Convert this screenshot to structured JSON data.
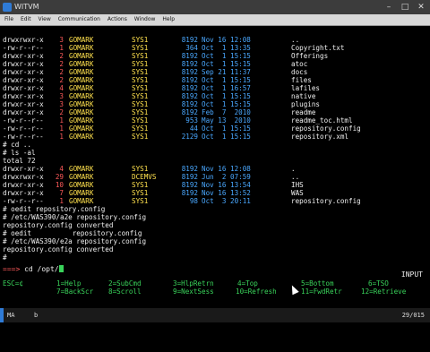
{
  "window": {
    "title": "WITVM"
  },
  "menu": [
    "File",
    "Edit",
    "View",
    "Communication",
    "Actions",
    "Window",
    "Help"
  ],
  "listing1": [
    {
      "perm": "drwxrwxr-x",
      "links": "3",
      "owner": "GOMARK",
      "group": "SYS1",
      "size": "8192",
      "date": "Nov 16 12:08",
      "name": ".."
    },
    {
      "perm": "-rw-r--r--",
      "links": "1",
      "owner": "GOMARK",
      "group": "SYS1",
      "size": "364",
      "date": "Oct  1 13:35",
      "name": "Copyright.txt"
    },
    {
      "perm": "drwxr-xr-x",
      "links": "2",
      "owner": "GOMARK",
      "group": "SYS1",
      "size": "8192",
      "date": "Oct  1 15:15",
      "name": "Offerings"
    },
    {
      "perm": "drwxr-xr-x",
      "links": "2",
      "owner": "GOMARK",
      "group": "SYS1",
      "size": "8192",
      "date": "Oct  1 15:15",
      "name": "atoc"
    },
    {
      "perm": "drwxr-xr-x",
      "links": "2",
      "owner": "GOMARK",
      "group": "SYS1",
      "size": "8192",
      "date": "Sep 21 11:37",
      "name": "docs"
    },
    {
      "perm": "drwxr-xr-x",
      "links": "2",
      "owner": "GOMARK",
      "group": "SYS1",
      "size": "8192",
      "date": "Oct  1 15:15",
      "name": "files"
    },
    {
      "perm": "drwxr-xr-x",
      "links": "4",
      "owner": "GOMARK",
      "group": "SYS1",
      "size": "8192",
      "date": "Oct  1 16:57",
      "name": "lafiles"
    },
    {
      "perm": "drwxr-xr-x",
      "links": "3",
      "owner": "GOMARK",
      "group": "SYS1",
      "size": "8192",
      "date": "Oct  1 15:15",
      "name": "native"
    },
    {
      "perm": "drwxr-xr-x",
      "links": "3",
      "owner": "GOMARK",
      "group": "SYS1",
      "size": "8192",
      "date": "Oct  1 15:15",
      "name": "plugins"
    },
    {
      "perm": "drwxr-xr-x",
      "links": "2",
      "owner": "GOMARK",
      "group": "SYS1",
      "size": "8192",
      "date": "Feb  7  2010",
      "name": "readme"
    },
    {
      "perm": "-rw-r--r--",
      "links": "1",
      "owner": "GOMARK",
      "group": "SYS1",
      "size": "953",
      "date": "May 13  2010",
      "name": "readme_toc.html"
    },
    {
      "perm": "-rw-r--r--",
      "links": "1",
      "owner": "GOMARK",
      "group": "SYS1",
      "size": "44",
      "date": "Oct  1 15:15",
      "name": "repository.config"
    },
    {
      "perm": "-rw-r--r--",
      "links": "1",
      "owner": "GOMARK",
      "group": "SYS1",
      "size": "2129",
      "date": "Oct  1 15:15",
      "name": "repository.xml"
    }
  ],
  "cmd1": "# cd ..",
  "cmd2": "# ls -al",
  "total": "total 72",
  "listing2": [
    {
      "perm": "drwxr-xr-x",
      "links": "4",
      "owner": "GOMARK",
      "group": "SYS1",
      "size": "8192",
      "date": "Nov 16 12:08",
      "name": "."
    },
    {
      "perm": "drwxrwxr-x",
      "links": "29",
      "owner": "GOMARK",
      "group": "DCEMVS",
      "size": "8192",
      "date": "Jun  2 07:59",
      "name": ".."
    },
    {
      "perm": "drwxr-xr-x",
      "links": "10",
      "owner": "GOMARK",
      "group": "SYS1",
      "size": "8192",
      "date": "Nov 16 13:54",
      "name": "IHS"
    },
    {
      "perm": "drwxr-xr-x",
      "links": "7",
      "owner": "GOMARK",
      "group": "SYS1",
      "size": "8192",
      "date": "Nov 16 13:52",
      "name": "WAS"
    },
    {
      "perm": "-rw-r--r--",
      "links": "1",
      "owner": "GOMARK",
      "group": "SYS1",
      "size": "98",
      "date": "Oct  3 20:11",
      "name": "repository.config"
    }
  ],
  "tail_lines": [
    "# oedit repository.config",
    "# /etc/WAS390/a2e repository.config",
    "repository.config converted",
    "# oedit          repository.config",
    "# /etc/WAS390/e2a repository.config",
    "repository.config converted",
    "#"
  ],
  "prompt": {
    "arrow": "===>",
    "text": " cd /opt/"
  },
  "input_label": "INPUT",
  "fkeys_row1": [
    {
      "key": "ESC=¢",
      "label": ""
    },
    {
      "key": "1=Help",
      "label": ""
    },
    {
      "key": "2=SubCmd",
      "label": ""
    },
    {
      "key": "3=HlpRetrn",
      "label": ""
    },
    {
      "key": "4=Top",
      "label": ""
    },
    {
      "key": "5=Bottom",
      "label": ""
    },
    {
      "key": "6=TSO",
      "label": ""
    }
  ],
  "fkeys_row2": [
    {
      "key": "7=BackScr",
      "label": ""
    },
    {
      "key": "8=Scroll",
      "label": ""
    },
    {
      "key": "9=NextSess",
      "label": ""
    },
    {
      "key": "10=Refresh",
      "label": ""
    },
    {
      "key": "11=FwdRetr",
      "label": ""
    },
    {
      "key": "12=Retrieve",
      "label": ""
    }
  ],
  "status": {
    "left": "MA",
    "b": "b",
    "right": "29/015"
  }
}
